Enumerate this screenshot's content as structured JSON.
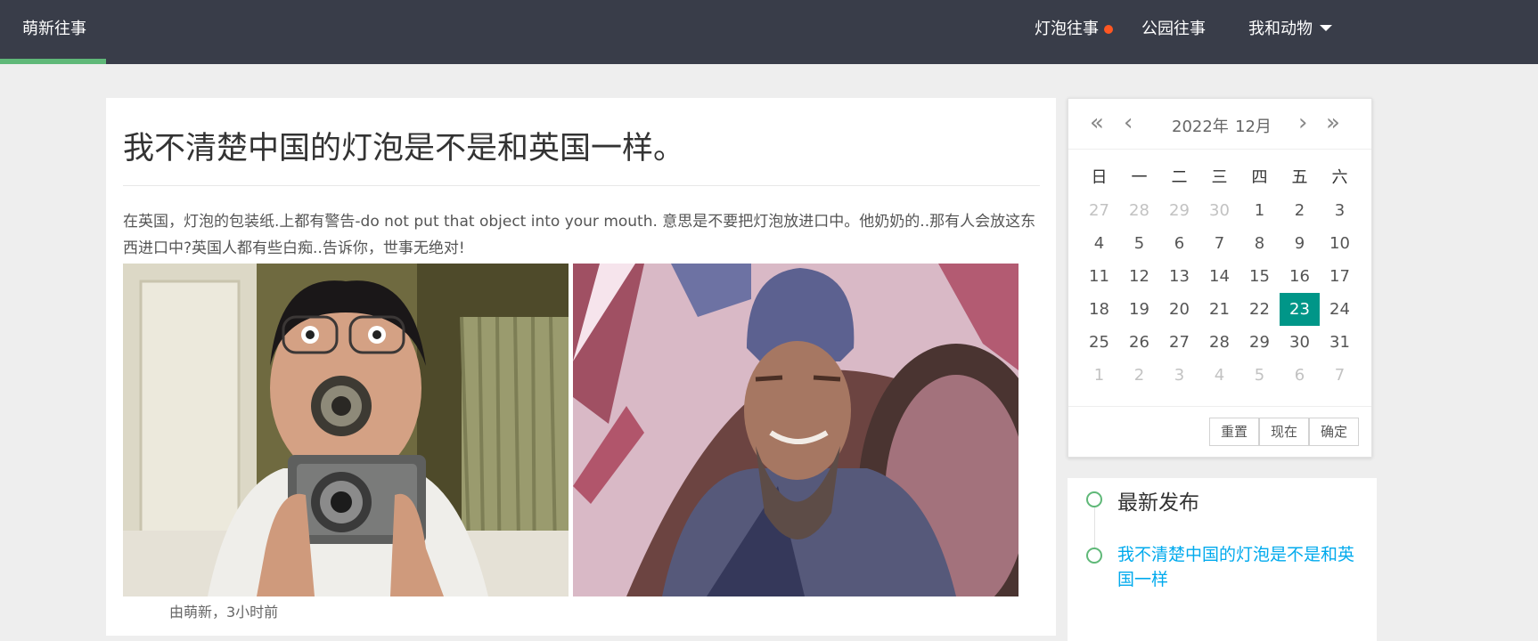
{
  "header": {
    "brand": "萌新往事",
    "nav": [
      {
        "label": "灯泡往事"
      },
      {
        "label": "公园往事"
      },
      {
        "label": "我和动物"
      }
    ]
  },
  "article": {
    "title": "我不清楚中国的灯泡是不是和英国一样。",
    "body": "在英国，灯泡的包装纸.上都有警告-do not put that object into your mouth. 意思是不要把灯泡放进口中。他奶奶的..那有人会放这东西进口中?英国人都有些白痴..告诉你，世事无绝对!",
    "meta": "由萌新，3小时前"
  },
  "calendar": {
    "year": "2022年",
    "month": "12月",
    "weekdays": [
      "日",
      "一",
      "二",
      "三",
      "四",
      "五",
      "六"
    ],
    "rows": [
      [
        "27",
        "28",
        "29",
        "30",
        "1",
        "2",
        "3"
      ],
      [
        "4",
        "5",
        "6",
        "7",
        "8",
        "9",
        "10"
      ],
      [
        "11",
        "12",
        "13",
        "14",
        "15",
        "16",
        "17"
      ],
      [
        "18",
        "19",
        "20",
        "21",
        "22",
        "23",
        "24"
      ],
      [
        "25",
        "26",
        "27",
        "28",
        "29",
        "30",
        "31"
      ],
      [
        "1",
        "2",
        "3",
        "4",
        "5",
        "6",
        "7"
      ]
    ],
    "selected_day": "23",
    "buttons": {
      "reset": "重置",
      "now": "现在",
      "confirm": "确定"
    }
  },
  "latest": {
    "heading": "最新发布",
    "link": "我不清楚中国的灯泡是不是和英国一样"
  },
  "colors": {
    "header_bg": "#393d49",
    "accent_green": "#5fb878",
    "selected_teal": "#009688",
    "link_blue": "#01aaed",
    "dot_orange": "#ff5722"
  }
}
